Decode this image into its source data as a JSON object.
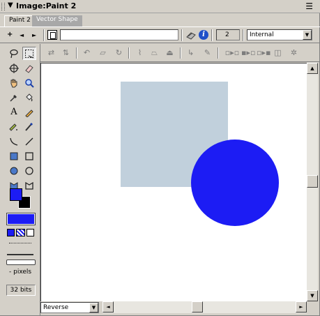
{
  "window": {
    "title": "Image:Paint 2",
    "collapse_glyph": "▼",
    "menu_glyph": "☰"
  },
  "tabs": [
    {
      "label": "Paint 2",
      "active": true
    },
    {
      "label": "Vector Shape",
      "active": false
    }
  ],
  "property_bar": {
    "nav_glyphs": [
      "+",
      "◄",
      "►"
    ],
    "member_name_value": "",
    "member_number": "2",
    "cast_dropdown": "Internal",
    "info_glyph": "i"
  },
  "tools_panel": {
    "tools": [
      "lasso-icon",
      "marquee-icon",
      "registration-point-icon",
      "eraser-icon",
      "hand-icon",
      "magnifier-icon",
      "eyedropper-icon",
      "paint-bucket-icon",
      "text-icon",
      "pencil-icon",
      "air-brush-icon",
      "paintbrush-icon",
      "arc-icon",
      "line-icon",
      "filled-rectangle-icon",
      "rectangle-icon",
      "filled-ellipse-icon",
      "ellipse-icon",
      "filled-polygon-icon",
      "polygon-icon"
    ],
    "selected_tool": "marquee-icon",
    "foreground_color": "#1c1cf4",
    "background_color": "#000000",
    "gradient_color": "#1c1cf4",
    "line_width_label": "- pixels",
    "color_depth": "32 bits"
  },
  "canvas": {
    "background": "#ffffff",
    "shapes": [
      {
        "type": "rectangle",
        "color": "#c1d0dc"
      },
      {
        "type": "circle",
        "color": "#1c1cf4"
      }
    ]
  },
  "bottom_bar": {
    "ink_dropdown": "Reverse"
  }
}
